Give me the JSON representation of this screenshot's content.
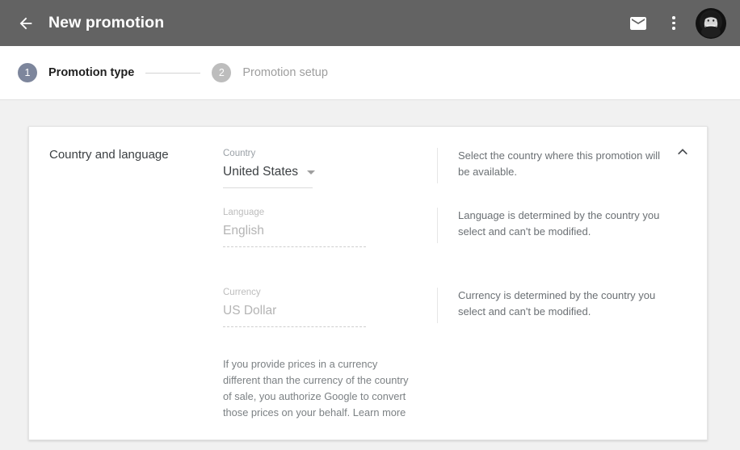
{
  "appbar": {
    "back_icon": "arrow-back-icon",
    "title": "New promotion",
    "mail_icon": "mail-icon",
    "overflow_icon": "more-vert-icon",
    "avatar_icon": "user-avatar"
  },
  "stepper": {
    "steps": [
      {
        "number": "1",
        "label": "Promotion type",
        "state": "active"
      },
      {
        "number": "2",
        "label": "Promotion setup",
        "state": "inactive"
      }
    ]
  },
  "card": {
    "section_title": "Country and language",
    "collapse_icon": "chevron-up-icon",
    "fields": {
      "country": {
        "label": "Country",
        "value": "United States",
        "caret_icon": "dropdown-caret-icon"
      },
      "language": {
        "label": "Language",
        "value": "English"
      },
      "currency": {
        "label": "Currency",
        "value": "US Dollar"
      }
    },
    "disclaimer": {
      "text": "If you provide prices in a currency different than the currency of the country of sale, you authorize Google to convert those prices on your behalf. ",
      "link_label": "Learn more"
    },
    "help": [
      "Select the country where this promotion will be available.",
      "Language is determined by the country you select and can't be modified.",
      "Currency is determined by the country you select and can't be modified."
    ]
  },
  "colors": {
    "appbar_bg": "#636363",
    "page_bg": "#f1f1f1",
    "card_bg": "#ffffff",
    "step_active": "#7d869c",
    "step_inactive": "#bdbdbd",
    "text_primary": "#3c4043",
    "text_secondary": "#9aa0a6",
    "text_disabled": "#b4b4b4"
  }
}
